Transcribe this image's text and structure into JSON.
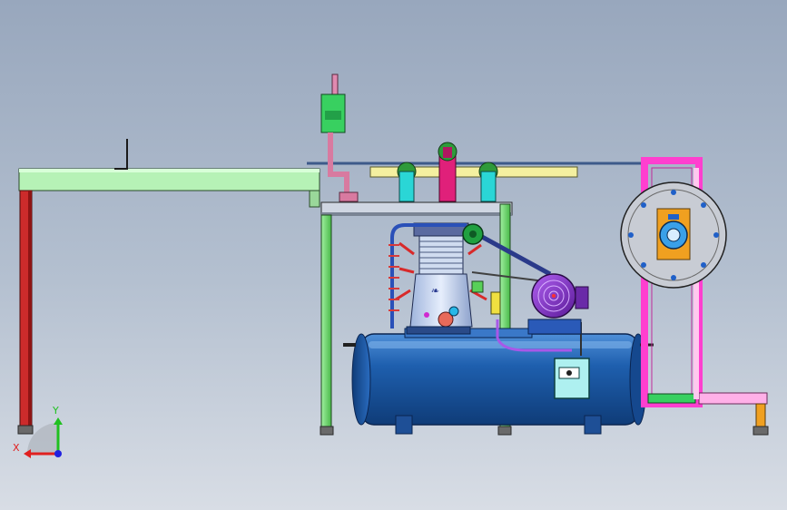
{
  "viewport": {
    "background_top": "#98a7bd",
    "background_bottom": "#d8dde5"
  },
  "colors": {
    "table_top": "#b4f0b4",
    "leg_red": "#cc2b2b",
    "leg_green": "#78d878",
    "frame_magenta": "#ff3fcf",
    "frame_pink": "#ffb0e8",
    "tank_blue": "#1e5fae",
    "tank_dark": "#0f3c78",
    "pump_body": "#c8d8f0",
    "motor_purple": "#8a2ed0",
    "cyan_part": "#28d4d4",
    "magenta_part": "#e0207a",
    "yellow_rod": "#f4f0a0",
    "orange_part": "#f0a020",
    "reel_blue": "#2060c8",
    "valve_green": "#38d060",
    "foot_gray": "#707070"
  },
  "triad": {
    "x_label": "X",
    "y_label": "Y",
    "x_color": "#e02020",
    "y_color": "#20c020",
    "origin_color": "#2020e0"
  },
  "icons": {
    "pump_badge": "jwp-logo-icon",
    "switch_box": "pressure-switch-icon"
  }
}
